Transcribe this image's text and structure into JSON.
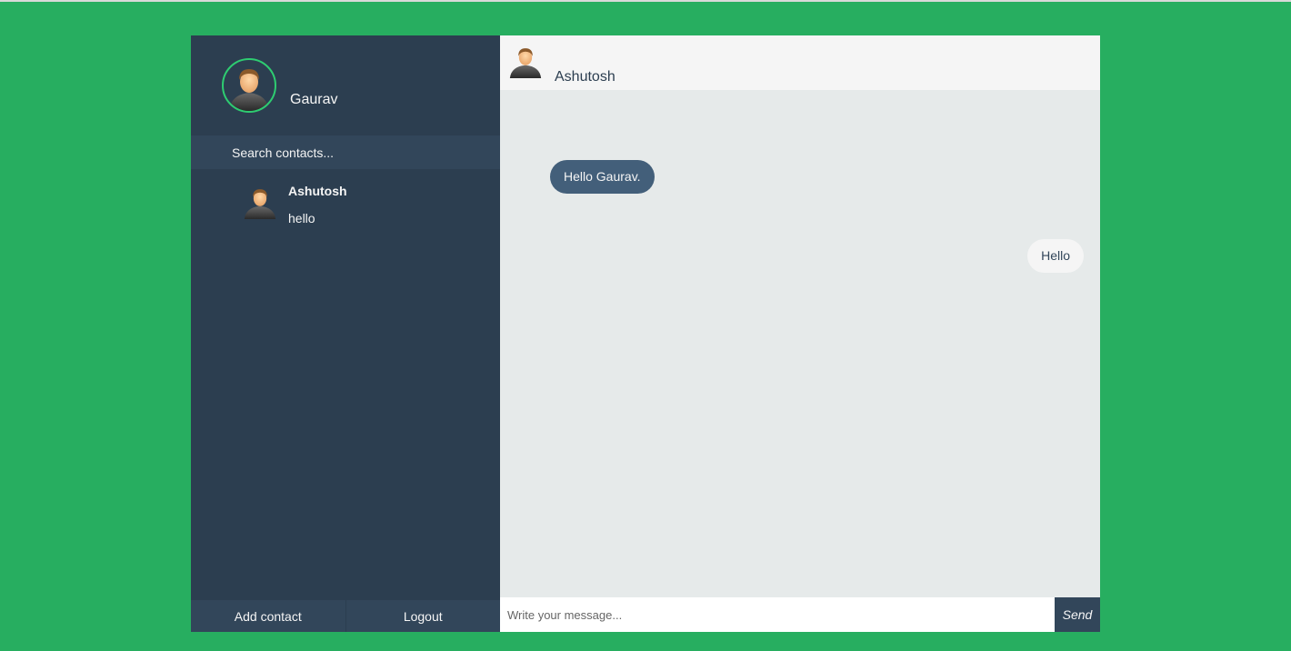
{
  "user": {
    "name": "Gaurav",
    "avatar_icon": "user-avatar-icon"
  },
  "search": {
    "placeholder": "Search contacts..."
  },
  "contacts": [
    {
      "name": "Ashutosh",
      "preview": "hello",
      "avatar_icon": "user-avatar-icon"
    }
  ],
  "bottom_bar": {
    "add_contact_label": "Add contact",
    "logout_label": "Logout"
  },
  "chat": {
    "contact_name": "Ashutosh",
    "messages": [
      {
        "direction": "received",
        "text": "Hello Gaurav."
      },
      {
        "direction": "sent",
        "text": "Hello"
      }
    ],
    "input_placeholder": "Write your message...",
    "send_label": "Send"
  },
  "colors": {
    "background": "#27ae60",
    "sidebar": "#2c3e50",
    "sidebar_light": "#32465a",
    "received_bubble": "#435f7a",
    "sent_bubble": "#f5f5f5",
    "chat_bg": "#e6eaea",
    "accent_ring": "#2ecc71"
  }
}
